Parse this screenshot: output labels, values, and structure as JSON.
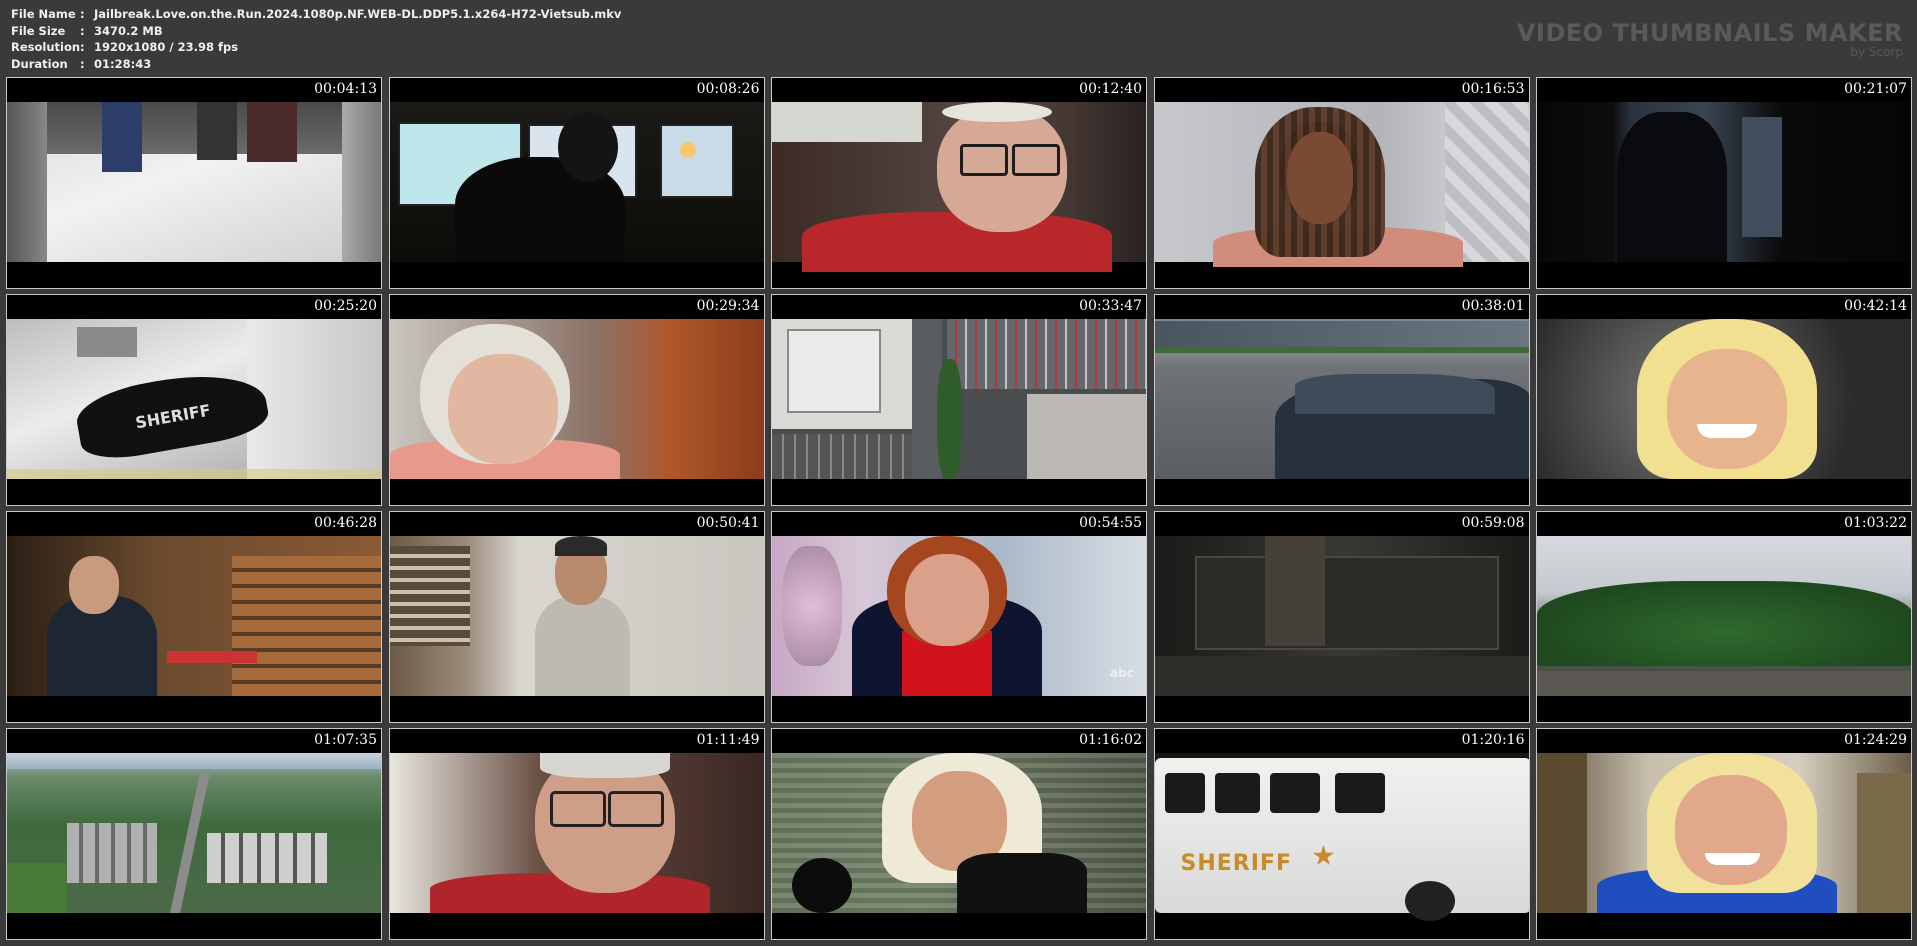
{
  "header": {
    "file_name_label": "File Name",
    "file_name": "Jailbreak.Love.on.the.Run.2024.1080p.NF.WEB-DL.DDP5.1.x264-H72-Vietsub.mkv",
    "file_size_label": "File Size",
    "file_size": "3470.2 MB",
    "resolution_label": "Resolution",
    "resolution": "1920x1080 / 23.98 fps",
    "duration_label": "Duration",
    "duration": "01:28:43",
    "separator": ":"
  },
  "branding": {
    "title": "VIDEO THUMBNAILS MAKER",
    "subtitle": "by Scorp"
  },
  "thumbnails": [
    {
      "timestamp": "00:04:13"
    },
    {
      "timestamp": "00:08:26"
    },
    {
      "timestamp": "00:12:40"
    },
    {
      "timestamp": "00:16:53"
    },
    {
      "timestamp": "00:21:07"
    },
    {
      "timestamp": "00:25:20",
      "overlay_text": "SHERIFF"
    },
    {
      "timestamp": "00:29:34"
    },
    {
      "timestamp": "00:33:47"
    },
    {
      "timestamp": "00:38:01"
    },
    {
      "timestamp": "00:42:14"
    },
    {
      "timestamp": "00:46:28"
    },
    {
      "timestamp": "00:50:41"
    },
    {
      "timestamp": "00:54:55"
    },
    {
      "timestamp": "00:59:08"
    },
    {
      "timestamp": "01:03:22"
    },
    {
      "timestamp": "01:07:35"
    },
    {
      "timestamp": "01:11:49"
    },
    {
      "timestamp": "01:16:02"
    },
    {
      "timestamp": "01:20:16",
      "overlay_text": "SHERIFF"
    },
    {
      "timestamp": "01:24:29"
    }
  ]
}
